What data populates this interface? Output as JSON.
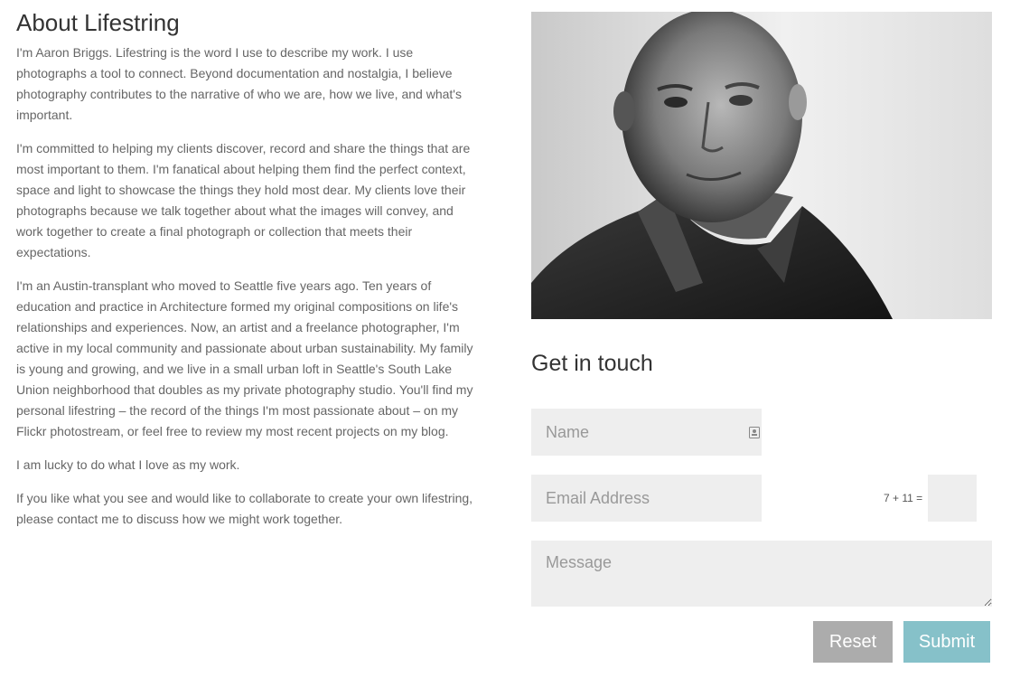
{
  "about": {
    "title": "About Lifestring",
    "paragraphs": [
      "I'm Aaron Briggs. Lifestring is the word I use to describe my work. I use photographs a tool to connect. Beyond documentation and nostalgia, I believe photography contributes to the narrative of who we are, how we live, and what's important.",
      "I'm committed to helping my clients discover, record and share the things that are most important to them. I'm fanatical about helping them find the perfect context, space and light to showcase the things they hold most dear. My clients love their photographs because we talk together about what the images will convey, and work together to create a final photograph or collection that meets their expectations.",
      "I'm an Austin-transplant who moved to Seattle five years ago. Ten years of education and practice in Architecture formed my original compositions on life's relationships and experiences. Now, an artist and a freelance photographer, I'm active in my local community and passionate about urban sustainability. My family is young and growing, and we live in a small urban loft in Seattle's South Lake Union neighborhood that doubles as my private photography studio. You'll find my personal lifestring – the record of the things I'm most passionate about – on my Flickr photostream, or feel free to review my most recent projects on my blog.",
      "I am lucky to do what I love as my work.",
      "If you like what you see and would like to collaborate to create your own lifestring, please contact me to discuss how we might work together."
    ]
  },
  "contact": {
    "title": "Get in touch",
    "name_placeholder": "Name",
    "name_value": "",
    "email_placeholder": "Email Address",
    "email_value": "",
    "captcha_question": "7 + 11 =",
    "captcha_value": "",
    "message_placeholder": "Message",
    "message_value": "",
    "reset_label": "Reset",
    "submit_label": "Submit"
  },
  "icons": {
    "name_field_icon": "contact-card-icon"
  },
  "colors": {
    "heading": "#333333",
    "body_text": "#666666",
    "field_bg": "#eeeeee",
    "reset_bg": "#acacac",
    "submit_bg": "#86c1c9"
  }
}
